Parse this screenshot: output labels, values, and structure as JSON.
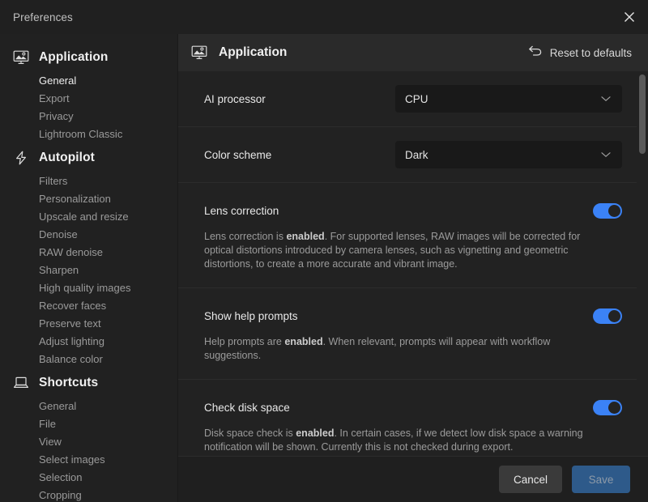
{
  "window": {
    "title": "Preferences",
    "close_icon": "close-icon"
  },
  "sidebar": {
    "groups": [
      {
        "title": "Application",
        "icon": "monitor-image-icon",
        "items": [
          {
            "label": "General",
            "selected": true
          },
          {
            "label": "Export",
            "selected": false
          },
          {
            "label": "Privacy",
            "selected": false
          },
          {
            "label": "Lightroom Classic",
            "selected": false
          }
        ]
      },
      {
        "title": "Autopilot",
        "icon": "lightning-bolt-icon",
        "items": [
          {
            "label": "Filters",
            "selected": false
          },
          {
            "label": "Personalization",
            "selected": false
          },
          {
            "label": "Upscale and resize",
            "selected": false
          },
          {
            "label": "Denoise",
            "selected": false
          },
          {
            "label": "RAW denoise",
            "selected": false
          },
          {
            "label": "Sharpen",
            "selected": false
          },
          {
            "label": "High quality images",
            "selected": false
          },
          {
            "label": "Recover faces",
            "selected": false
          },
          {
            "label": "Preserve text",
            "selected": false
          },
          {
            "label": "Adjust lighting",
            "selected": false
          },
          {
            "label": "Balance color",
            "selected": false
          }
        ]
      },
      {
        "title": "Shortcuts",
        "icon": "laptop-icon",
        "items": [
          {
            "label": "General",
            "selected": false
          },
          {
            "label": "File",
            "selected": false
          },
          {
            "label": "View",
            "selected": false
          },
          {
            "label": "Select images",
            "selected": false
          },
          {
            "label": "Selection",
            "selected": false
          },
          {
            "label": "Cropping",
            "selected": false
          }
        ]
      }
    ]
  },
  "content": {
    "header": {
      "icon": "monitor-image-icon",
      "title": "Application",
      "reset_label": "Reset to defaults",
      "reset_icon": "undo-arrow-icon"
    },
    "rows": [
      {
        "type": "select",
        "label": "AI processor",
        "value": "CPU",
        "options": [
          "CPU"
        ]
      },
      {
        "type": "select",
        "label": "Color scheme",
        "value": "Dark",
        "options": [
          "Dark"
        ]
      },
      {
        "type": "toggle",
        "label": "Lens correction",
        "state": "on",
        "desc_before": "Lens correction is ",
        "desc_strong": "enabled",
        "desc_after": ". For supported lenses, RAW images will be corrected for optical distortions introduced by camera lenses, such as vignetting and geometric distortions, to create a more accurate and vibrant image."
      },
      {
        "type": "toggle",
        "label": "Show help prompts",
        "state": "on",
        "desc_before": "Help prompts are ",
        "desc_strong": "enabled",
        "desc_after": ". When relevant, prompts will appear with workflow suggestions."
      },
      {
        "type": "toggle",
        "label": "Check disk space",
        "state": "on",
        "desc_before": "Disk space check is ",
        "desc_strong": "enabled",
        "desc_after": ". In certain cases, if we detect low disk space a warning notification will be shown. Currently this is not checked during export."
      }
    ]
  },
  "footer": {
    "cancel_label": "Cancel",
    "save_label": "Save"
  },
  "colors": {
    "accent": "#3b82f6",
    "save_button": "#2e5a8a",
    "window_bg": "#1c1c1c",
    "sidebar_bg": "#212121",
    "content_bg": "#222222"
  }
}
